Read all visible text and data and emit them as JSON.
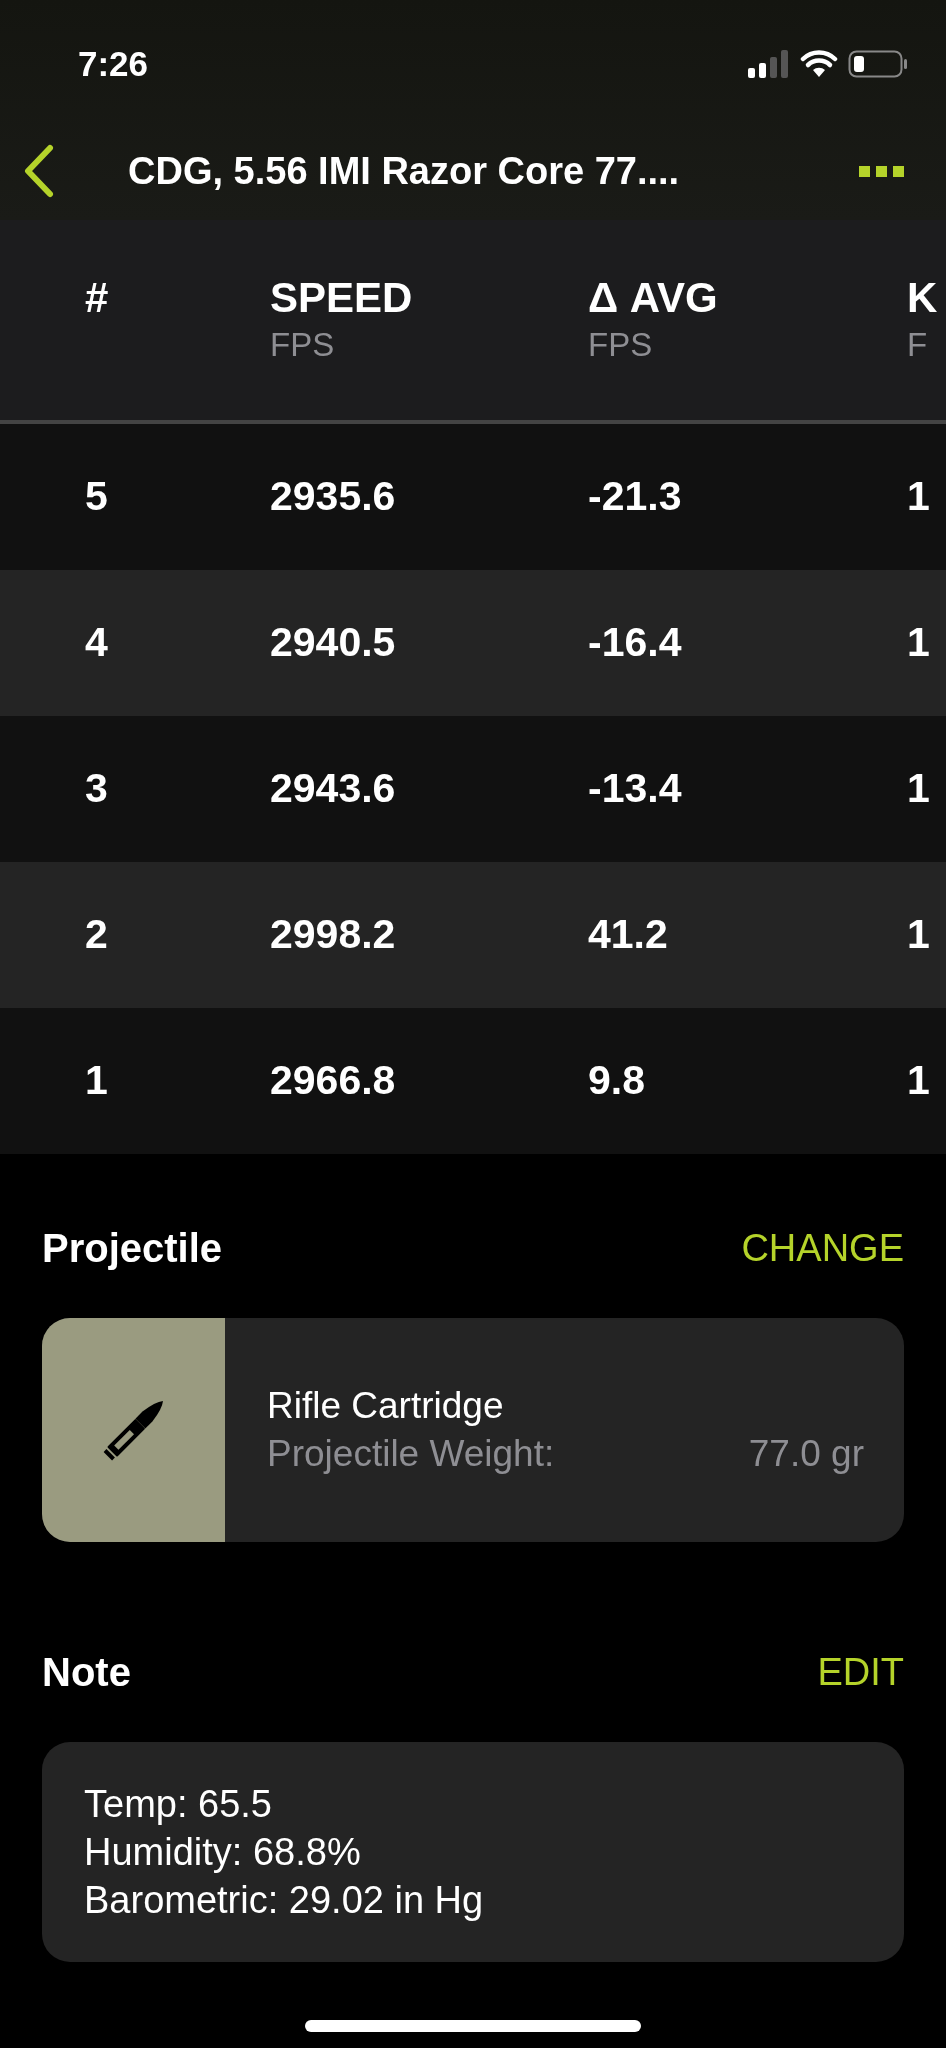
{
  "status_bar": {
    "time": "7:26"
  },
  "nav": {
    "title": "CDG, 5.56 IMI Razor Core 77...."
  },
  "table": {
    "columns": [
      {
        "title": "#"
      },
      {
        "title": "SPEED",
        "unit": "FPS"
      },
      {
        "title": "Δ AVG",
        "unit": "FPS"
      },
      {
        "title": "K",
        "unit": "F"
      }
    ],
    "rows": [
      [
        "5",
        "2935.6",
        "-21.3",
        "1"
      ],
      [
        "4",
        "2940.5",
        "-16.4",
        "1"
      ],
      [
        "3",
        "2943.6",
        "-13.4",
        "1"
      ],
      [
        "2",
        "2998.2",
        "41.2",
        "1"
      ],
      [
        "1",
        "2966.8",
        "9.8",
        "1"
      ]
    ]
  },
  "projectile": {
    "heading": "Projectile",
    "action": "CHANGE",
    "name": "Rifle Cartridge",
    "label": "Projectile Weight:",
    "value": "77.0 gr"
  },
  "note": {
    "heading": "Note",
    "action": "EDIT",
    "lines": [
      "Temp: 65.5",
      "Humidity: 68.8%",
      "Barometric: 29.02 in Hg"
    ]
  }
}
